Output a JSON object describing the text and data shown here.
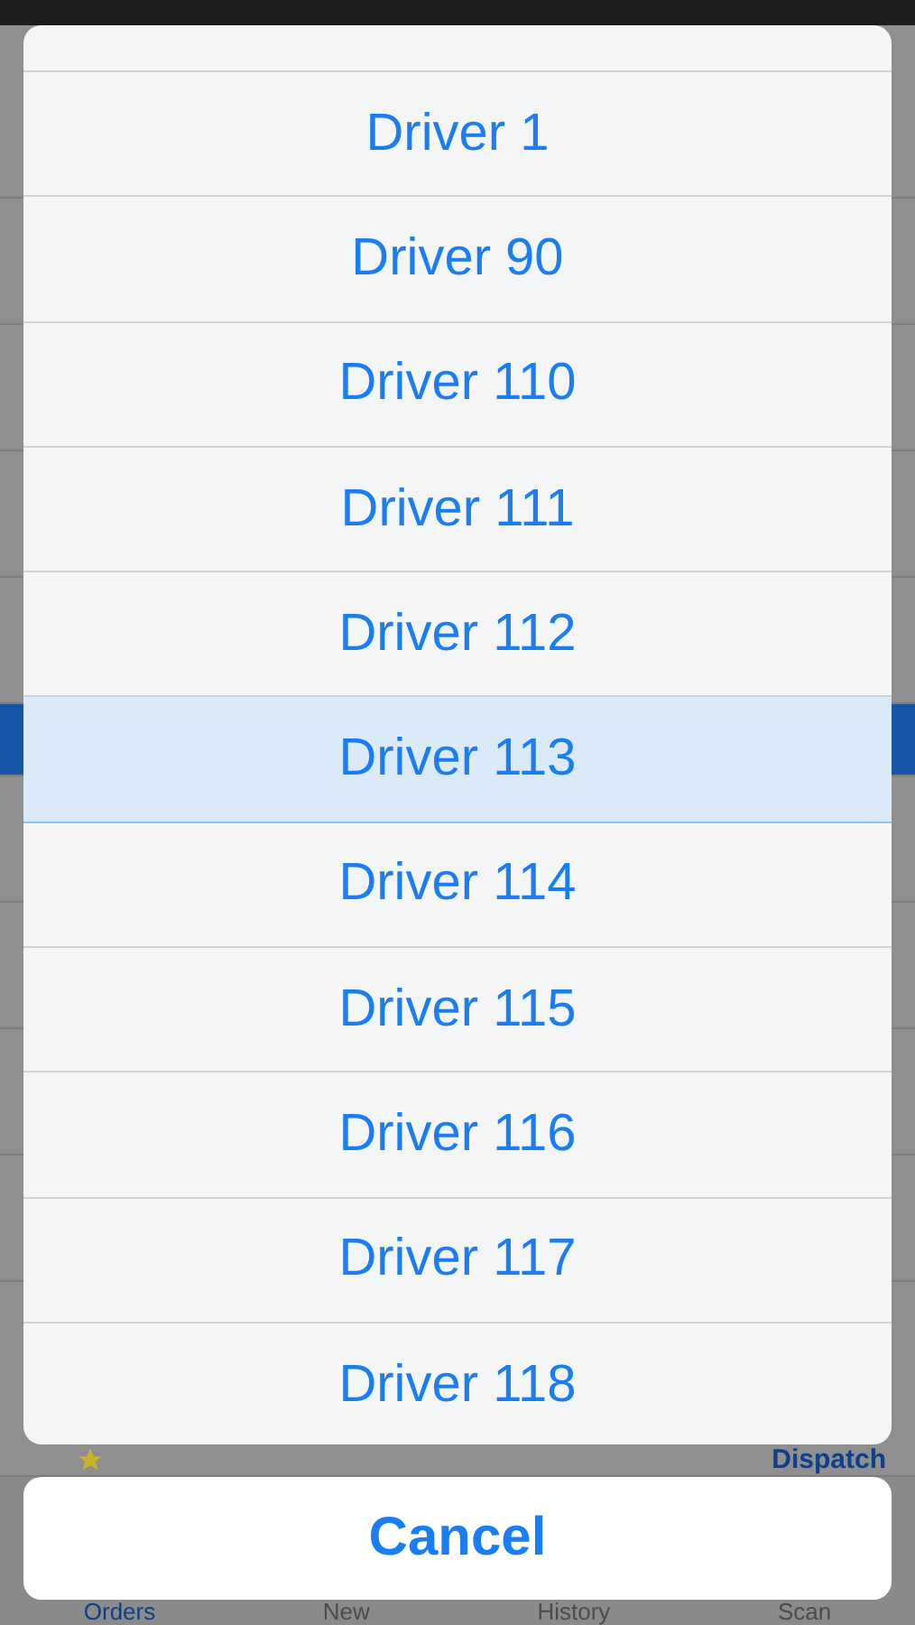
{
  "background": {
    "rows": [
      {
        "selected": false
      },
      {
        "selected": false
      },
      {
        "selected": false
      },
      {
        "selected": false
      },
      {
        "selected": false
      },
      {
        "selected": true
      },
      {
        "selected": false
      },
      {
        "selected": false
      },
      {
        "selected": false
      },
      {
        "selected": false
      }
    ],
    "action": "Dispatch",
    "tabs": [
      {
        "label": "Orders",
        "selected": true
      },
      {
        "label": "New",
        "selected": false
      },
      {
        "label": "History",
        "selected": false
      },
      {
        "label": "Scan",
        "selected": false
      }
    ]
  },
  "action_sheet": {
    "options": [
      {
        "label": "Driver 1",
        "selected": false
      },
      {
        "label": "Driver 90",
        "selected": false
      },
      {
        "label": "Driver 110",
        "selected": false
      },
      {
        "label": "Driver 111",
        "selected": false
      },
      {
        "label": "Driver 112",
        "selected": false
      },
      {
        "label": "Driver 113",
        "selected": true
      },
      {
        "label": "Driver 114",
        "selected": false
      },
      {
        "label": "Driver 115",
        "selected": false
      },
      {
        "label": "Driver 116",
        "selected": false
      },
      {
        "label": "Driver 117",
        "selected": false
      },
      {
        "label": "Driver 118",
        "selected": false
      }
    ],
    "cancel": "Cancel"
  }
}
